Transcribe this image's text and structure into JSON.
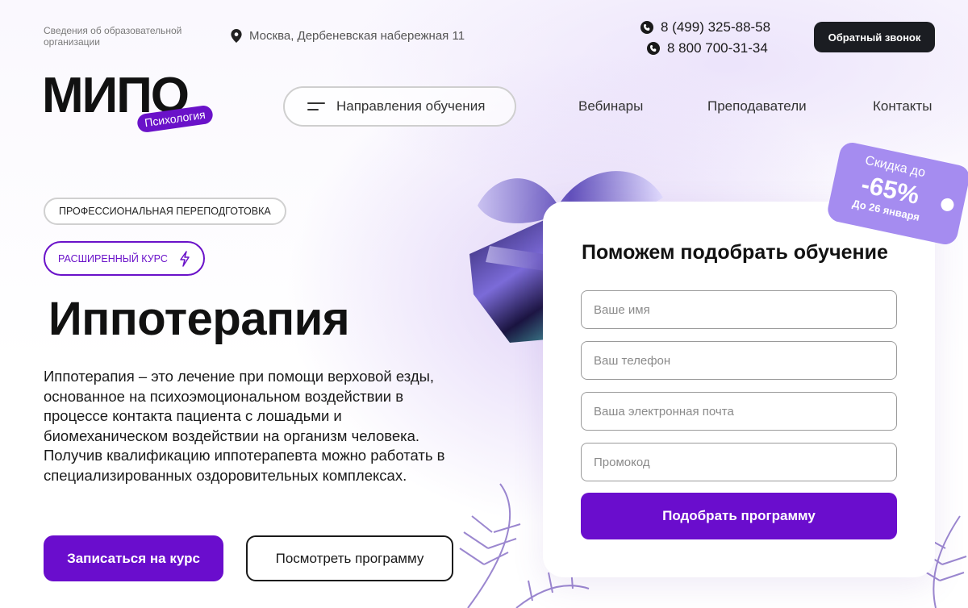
{
  "header": {
    "org_info": "Сведения об образовательной организации",
    "address": "Москва, Дербеневская набережная 11",
    "phone_1": "8 (499) 325-88-58",
    "phone_2": "8 800 700-31-34",
    "callback_label": "Обратный звонок"
  },
  "logo": {
    "text": "МИПО",
    "badge": "Психология"
  },
  "nav": {
    "directions_label": "Направления обучения",
    "links": [
      "Вебинары",
      "Преподаватели",
      "Контакты"
    ]
  },
  "hero": {
    "tag_professional": "ПРОФЕССИОНАЛЬНАЯ ПЕРЕПОДГОТОВКА",
    "tag_extended": "РАСШИРЕННЫЙ КУРС",
    "title": "Иппотерапия",
    "description": "Иппотерапия – это лечение при помощи верховой езды, основанное на психоэмоциональном воздействии в процессе контакта пациента с лошадьми и биомеханическом воздействии на организм человека. Получив квалификацию иппотерапевта можно работать в специализированных оздоровительных комплексах.",
    "enroll_label": "Записаться на курс",
    "program_label": "Посмотреть программу"
  },
  "form": {
    "title": "Поможем подобрать обучение",
    "name_placeholder": "Ваше имя",
    "phone_placeholder": "Ваш телефон",
    "email_placeholder": "Ваша электронная почта",
    "promo_placeholder": "Промокод",
    "submit_label": "Подобрать программу"
  },
  "discount": {
    "line1": "Скидка до",
    "value": "-65%",
    "line3": "До 26 января"
  },
  "colors": {
    "accent": "#6a0dcd",
    "discount_bg": "#a58cf0",
    "dark_button": "#1b1d22"
  },
  "icons": [
    "location-pin-icon",
    "phone-icon",
    "menu-icon",
    "lightning-icon"
  ]
}
